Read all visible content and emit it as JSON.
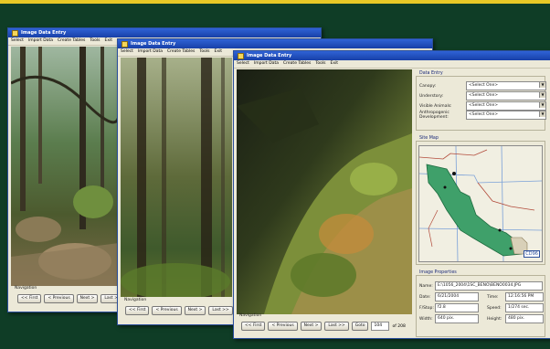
{
  "window_title": "Image Data Entry",
  "menu": [
    "Select",
    "Import Data",
    "Create Tables",
    "Tools",
    "Exit"
  ],
  "navigation_label": "Navigation",
  "nav_buttons": {
    "first": "<< First",
    "previous": "< Previous",
    "next": "Next >",
    "last": "Last >>",
    "goto": "Goto"
  },
  "record": {
    "current": "104",
    "of_text": "of 208"
  },
  "data_entry": {
    "title": "Data Entry",
    "fields": [
      {
        "label": "Canopy:",
        "value": "<Select One>"
      },
      {
        "label": "Understory:",
        "value": "<Select One>"
      },
      {
        "label": "Visible Animals:",
        "value": "<Select One>"
      },
      {
        "label": "Anthropogenic Development:",
        "value": "<Select One>"
      }
    ]
  },
  "site_map": {
    "title": "Site Map",
    "code_badge": "CD96"
  },
  "image_properties": {
    "title": "Image Properties",
    "name_label": "Name:",
    "name_value": "E:\\1056_2004\\1SC_BENO\\BENO0034.JPG",
    "date_label": "Date:",
    "date_value": "6/21/2004",
    "time_label": "Time:",
    "time_value": "12:16:56 PM",
    "fstop_label": "F/Stop:",
    "fstop_value": "f2.8",
    "speed_label": "Speed:",
    "speed_value": "1/274 sec.",
    "width_label": "Width:",
    "width_value": "640 pix.",
    "height_label": "Height:",
    "height_value": "480 pix."
  },
  "colors": {
    "background": "#0f3d26",
    "accent_strip": "#e8c826",
    "titlebar": "#1f4fc4"
  }
}
